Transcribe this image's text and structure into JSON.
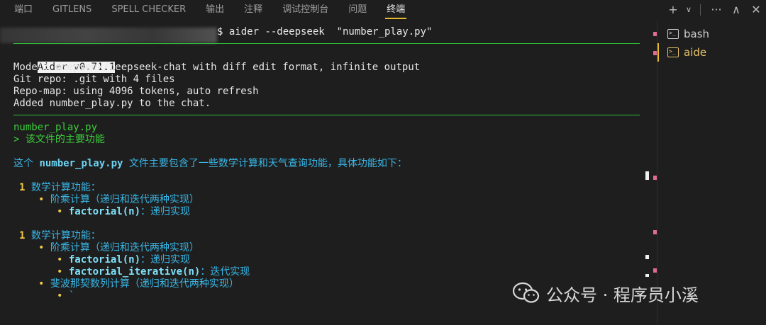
{
  "tabs": [
    {
      "label": "端口",
      "active": false
    },
    {
      "label": "GITLENS",
      "active": false
    },
    {
      "label": "SPELL CHECKER",
      "active": false
    },
    {
      "label": "输出",
      "active": false
    },
    {
      "label": "注释",
      "active": false
    },
    {
      "label": "调试控制台",
      "active": false
    },
    {
      "label": "问题",
      "active": false
    },
    {
      "label": "终端",
      "active": true
    }
  ],
  "tab_actions": {
    "add": "+",
    "dropdown": "∨",
    "more": "···",
    "collapse": "∧",
    "close": "✕"
  },
  "terminal": {
    "command": "$ aider --deepseek  \"number_play.py\"",
    "version": "Aider v0.71.1",
    "info_lines": [
      "Model: deepseek/deepseek-chat with diff edit format, infinite output",
      "Git repo: .git with 4 files",
      "Repo-map: using 4096 tokens, auto refresh",
      "Added number_play.py to the chat."
    ],
    "file_name": "number_play.py",
    "user_prompt": "> 该文件的主要功能",
    "answer_prefix": "这个 ",
    "answer_file": "number_play.py",
    "answer_suffix": " 文件主要包含了一些数学计算和天气查询功能，具体功能如下：",
    "sections": [
      {
        "number": "1",
        "title": "数学计算功能：",
        "bullet1": "阶乘计算（递归和迭代两种实现）",
        "sub1_name": "factorial(n)",
        "sub1_desc": "：递归实现"
      },
      {
        "number": "1",
        "title": "数学计算功能：",
        "bullet1": "阶乘计算（递归和迭代两种实现）",
        "sub1_name": "factorial(n)",
        "sub1_desc": "：递归实现",
        "sub2_name": "factorial_iterative(n)",
        "sub2_desc": "：迭代实现",
        "bullet2": "斐波那契数列计算（递归和迭代两种实现）",
        "sub3": "`"
      }
    ]
  },
  "terminal_list": [
    {
      "label": "bash",
      "icon": "terminal-icon",
      "active": false
    },
    {
      "label": "aide",
      "icon": "terminal-icon",
      "active": true
    }
  ],
  "watermark": {
    "text": "公众号 · 程序员小溪"
  },
  "colors": {
    "accent": "#e5b92d",
    "green": "#3ccf3c",
    "blue": "#39b6e6"
  }
}
